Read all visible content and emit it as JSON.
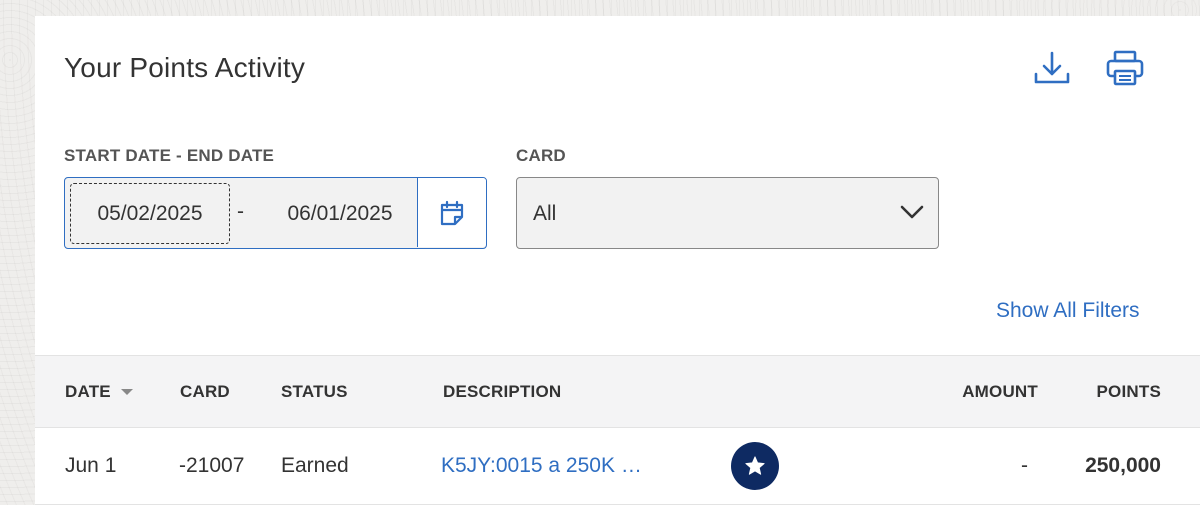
{
  "header": {
    "title": "Your Points Activity",
    "download_icon": "download-icon",
    "print_icon": "print-icon"
  },
  "filters": {
    "date_label": "START DATE - END DATE",
    "start_date": "05/02/2025",
    "separator": "-",
    "end_date": "06/01/2025",
    "calendar_icon": "calendar-icon",
    "card_label": "CARD",
    "card_value": "All",
    "show_all_filters": "Show All Filters"
  },
  "table": {
    "columns": {
      "date": "DATE",
      "card": "CARD",
      "status": "STATUS",
      "description": "DESCRIPTION",
      "amount": "AMOUNT",
      "points": "POINTS"
    },
    "rows": [
      {
        "date": "Jun 1",
        "card": "-21007",
        "status": "Earned",
        "description": "K5JY:0015 a 250K …",
        "badge_icon": "star-icon",
        "amount": "-",
        "points": "250,000"
      }
    ]
  },
  "colors": {
    "accent": "#2f6ec2",
    "badge": "#0e2a62",
    "header_bg": "#f4f4f5"
  }
}
